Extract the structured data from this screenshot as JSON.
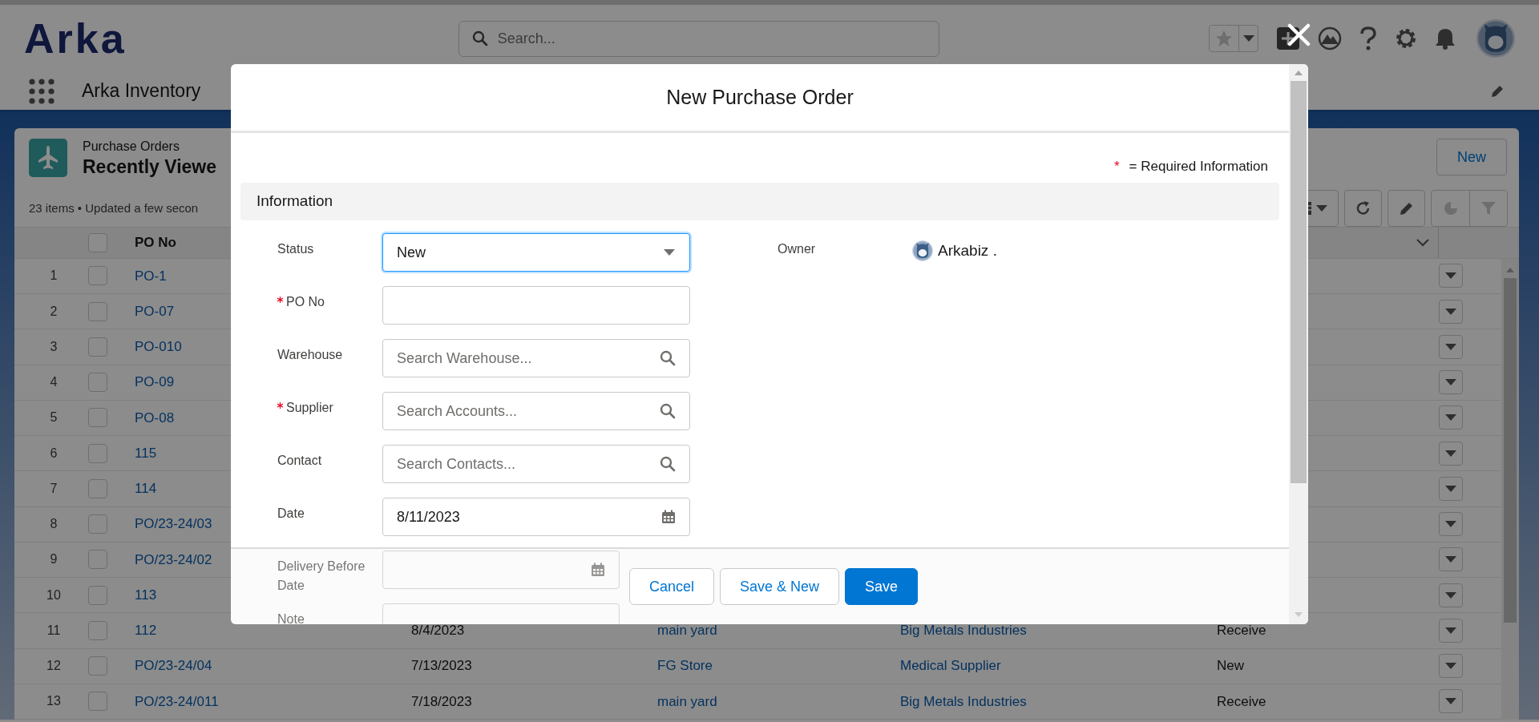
{
  "header": {
    "logo": "Arka",
    "search": {
      "placeholder": "Search..."
    }
  },
  "nav": {
    "app_name": "Arka Inventory"
  },
  "list": {
    "object": "Purchase Orders",
    "view": "Recently Viewe",
    "summary": "23 items • Updated a few secon",
    "new_button": "New",
    "select_all_checked": false,
    "column": "PO No",
    "rows": [
      {
        "num": "1",
        "po_no": "PO-1",
        "checked": false
      },
      {
        "num": "2",
        "po_no": "PO-07",
        "checked": false
      },
      {
        "num": "3",
        "po_no": "PO-010",
        "checked": false
      },
      {
        "num": "4",
        "po_no": "PO-09",
        "checked": false
      },
      {
        "num": "5",
        "po_no": "PO-08",
        "checked": false
      },
      {
        "num": "6",
        "po_no": "115",
        "checked": false
      },
      {
        "num": "7",
        "po_no": "114",
        "checked": false
      },
      {
        "num": "8",
        "po_no": "PO/23-24/03",
        "checked": false
      },
      {
        "num": "9",
        "po_no": "PO/23-24/02",
        "checked": false
      },
      {
        "num": "10",
        "po_no": "113",
        "checked": false
      },
      {
        "num": "11",
        "po_no": "112",
        "date": "8/4/2023",
        "warehouse": "main yard",
        "supplier": "Big Metals Industries",
        "status": "Receive",
        "checked": false
      },
      {
        "num": "12",
        "po_no": "PO/23-24/04",
        "date": "7/13/2023",
        "warehouse": "FG Store",
        "supplier": "Medical Supplier",
        "status": "New",
        "checked": false
      },
      {
        "num": "13",
        "po_no": "PO/23-24/011",
        "date": "7/18/2023",
        "warehouse": "main yard",
        "supplier": "Big Metals Industries",
        "status": "Receive",
        "checked": false
      }
    ]
  },
  "modal": {
    "title": "New Purchase Order",
    "required_legend": {
      "mark": "*",
      "text": "= Required Information"
    },
    "section": "Information",
    "fields": [
      {
        "kind": "picklist",
        "label": "Status",
        "required": false,
        "value": "New",
        "focused": true
      },
      {
        "kind": "text",
        "label": "PO No",
        "required": true,
        "focused": false
      },
      {
        "kind": "lookup",
        "label": "Warehouse",
        "required": false,
        "placeholder": "Search Warehouse...",
        "focused": false
      },
      {
        "kind": "lookup",
        "label": "Supplier",
        "required": true,
        "placeholder": "Search Accounts...",
        "focused": false
      },
      {
        "kind": "lookup",
        "label": "Contact",
        "required": false,
        "placeholder": "Search Contacts...",
        "focused": false
      },
      {
        "kind": "date",
        "label": "Date",
        "required": false,
        "value": "8/11/2023",
        "focused": false
      },
      {
        "kind": "date",
        "label": "Delivery Before Date",
        "required": false,
        "focused": false
      },
      {
        "kind": "text",
        "label": "Note",
        "required": false,
        "focused": false
      }
    ],
    "owner": {
      "label": "Owner",
      "value": "Arkabiz ."
    },
    "buttons": [
      {
        "label": "Cancel",
        "primary": false
      },
      {
        "label": "Save & New",
        "primary": false
      },
      {
        "label": "Save",
        "primary": true
      }
    ]
  }
}
